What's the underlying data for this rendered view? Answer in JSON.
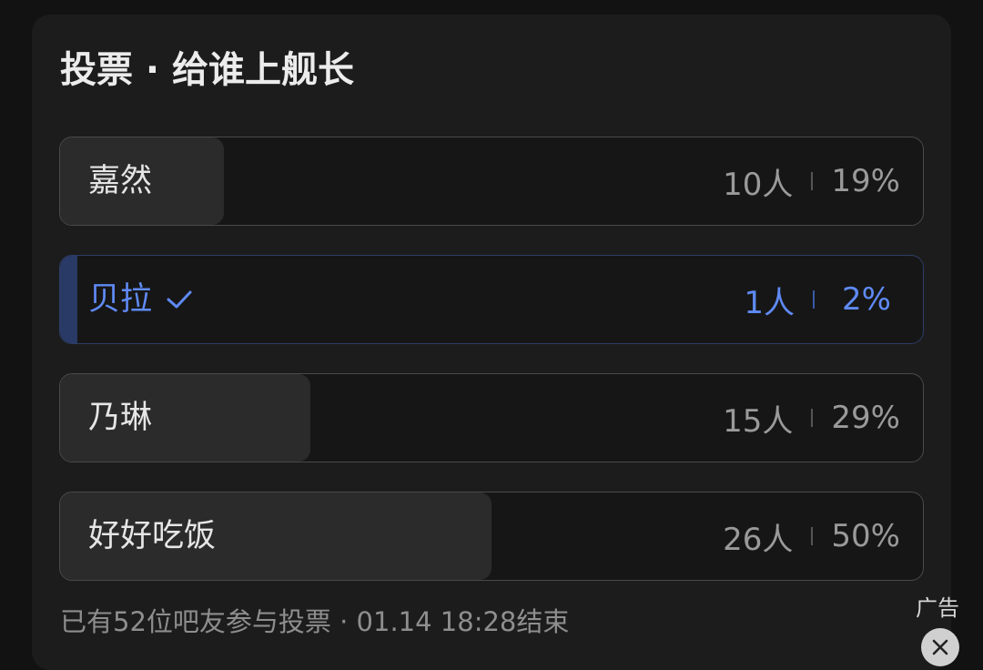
{
  "poll": {
    "title": "投票 · 给谁上舰长",
    "options": [
      {
        "label": "嘉然",
        "count": "10人",
        "percent": "19%",
        "share": 0.19,
        "selected": false
      },
      {
        "label": "贝拉",
        "count": "1人",
        "percent": "2%",
        "share": 0.02,
        "selected": true
      },
      {
        "label": "乃琳",
        "count": "15人",
        "percent": "29%",
        "share": 0.29,
        "selected": false
      },
      {
        "label": "好好吃饭",
        "count": "26人",
        "percent": "50%",
        "share": 0.5,
        "selected": false
      }
    ],
    "footer": "已有52位吧友参与投票 · 01.14 18:28结束"
  },
  "ad": {
    "label": "广告",
    "close_icon": "close-icon"
  },
  "colors": {
    "accent": "#5f8af5",
    "card_bg": "#1c1c1c",
    "bar_fill": "#2b2b2b"
  }
}
